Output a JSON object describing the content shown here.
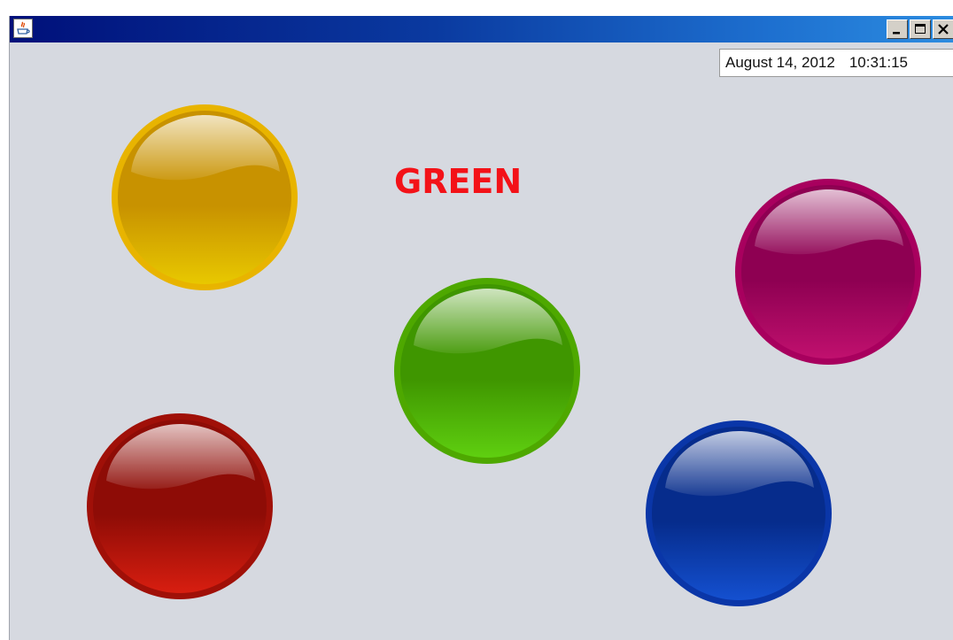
{
  "window": {
    "controls": {
      "minimize": "minimize-icon",
      "maximize": "maximize-icon",
      "close": "close-icon"
    }
  },
  "datetime": {
    "date": "August 14, 2012",
    "time": "10:31:15"
  },
  "target_color_label": "GREEN",
  "balls": [
    {
      "color": "yellow",
      "base": "#e8c800",
      "dark": "#c89200",
      "rim": "#e8b400"
    },
    {
      "color": "magenta",
      "base": "#c0106e",
      "dark": "#8e0052",
      "rim": "#a8005e"
    },
    {
      "color": "green",
      "base": "#5fcf10",
      "dark": "#3f9600",
      "rim": "#4ea800"
    },
    {
      "color": "red",
      "base": "#d81e10",
      "dark": "#8e0c06",
      "rim": "#a01008"
    },
    {
      "color": "blue",
      "base": "#1450d0",
      "dark": "#062c8c",
      "rim": "#0a36a8"
    }
  ],
  "colors": {
    "label": "#f31218",
    "background": "#d6d9e0"
  }
}
